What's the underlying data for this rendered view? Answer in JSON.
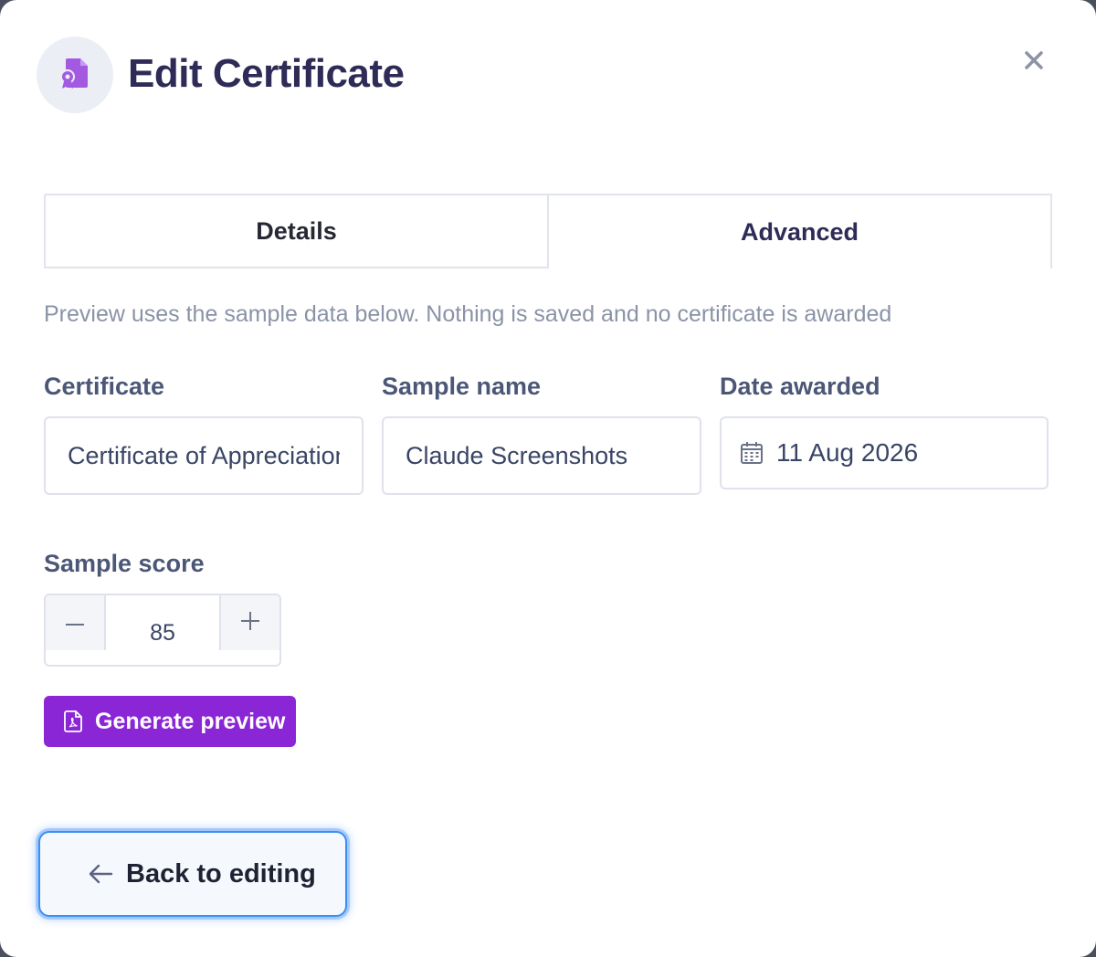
{
  "header": {
    "title": "Edit Certificate",
    "icon": "certificate-icon",
    "close_icon": "close-icon"
  },
  "tabs": [
    {
      "label": "Details",
      "active": true
    },
    {
      "label": "Advanced",
      "active": false
    }
  ],
  "hint": "Preview uses the sample data below. Nothing is saved and no certificate is awarded",
  "fields": {
    "certificate": {
      "label": "Certificate",
      "value": "Certificate of Appreciation"
    },
    "sample_name": {
      "label": "Sample name",
      "value": "Claude Screenshots"
    },
    "date_awarded": {
      "label": "Date awarded",
      "value": "11 Aug 2026",
      "icon": "calendar-icon"
    }
  },
  "score": {
    "label": "Sample score",
    "value": "85",
    "minus_icon": "minus-icon",
    "plus_icon": "plus-icon"
  },
  "actions": {
    "generate_label": "Generate preview",
    "generate_icon": "pdf-file-icon",
    "back_label": "Back to editing",
    "back_icon": "arrow-left-icon"
  },
  "colors": {
    "accent": "#8b26d6",
    "title": "#2e2b57",
    "focus_ring": "#3b8ff5"
  }
}
